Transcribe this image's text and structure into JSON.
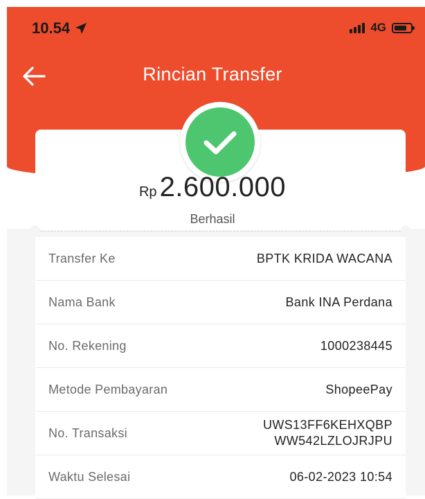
{
  "status_bar": {
    "time": "10.54",
    "network": "4G"
  },
  "header": {
    "title": "Rincian Transfer"
  },
  "summary": {
    "currency": "Rp",
    "amount": "2.600.000",
    "status": "Berhasil"
  },
  "details": [
    {
      "label": "Transfer Ke",
      "value": "BPTK KRIDA WACANA"
    },
    {
      "label": "Nama Bank",
      "value": "Bank INA Perdana"
    },
    {
      "label": "No. Rekening",
      "value": "1000238445"
    },
    {
      "label": "Metode Pembayaran",
      "value": "ShopeePay"
    },
    {
      "label": "No. Transaksi",
      "value": "UWS13FF6KEHXQBP",
      "value2": "WW542LZLOJRJPU"
    },
    {
      "label": "Waktu Selesai",
      "value": "06-02-2023 10:54"
    }
  ],
  "colors": {
    "brand": "#ee4d2d",
    "success": "#4ec66f"
  },
  "icons": [
    "location-arrow-icon",
    "signal-icon",
    "battery-icon",
    "back-arrow-icon",
    "check-icon"
  ]
}
